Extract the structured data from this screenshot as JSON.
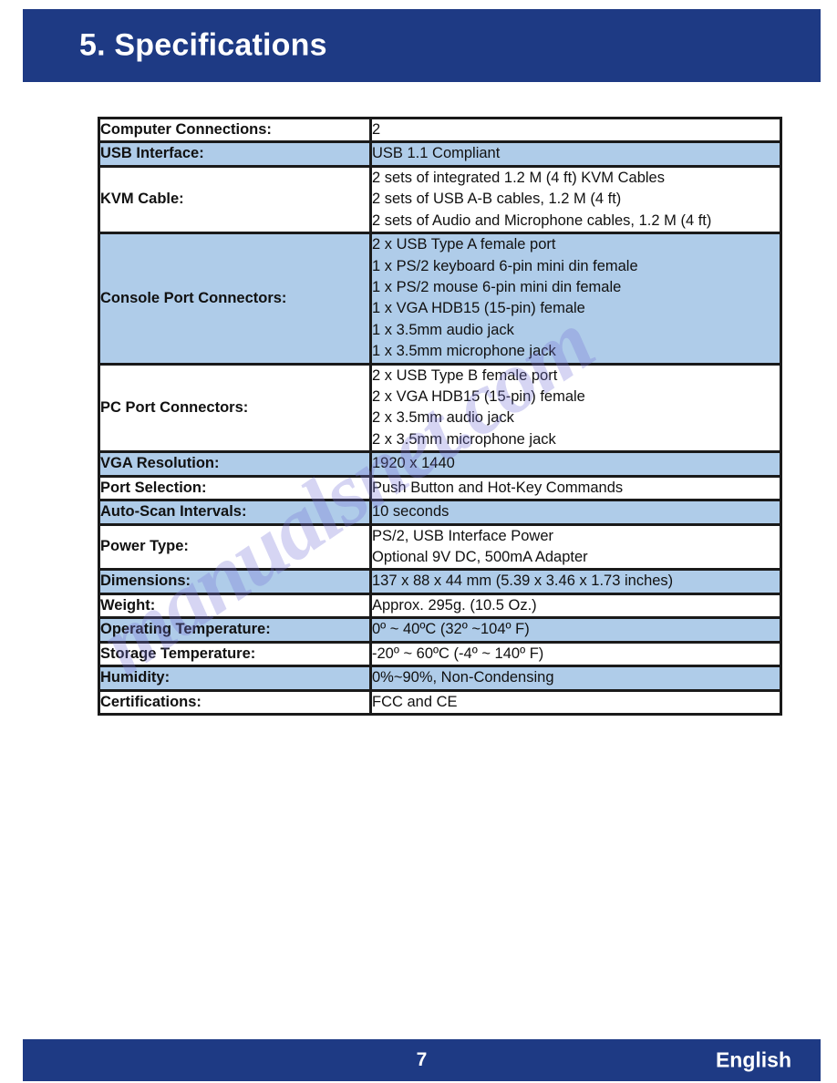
{
  "page": {
    "header_title": "5. Specifications",
    "accent_color": "#1E3A84",
    "shaded_row_color": "#AFCCE9",
    "watermark_text": "manualsnet.com"
  },
  "spec_table": {
    "rows": [
      {
        "label": "Computer Connections:",
        "value": "2",
        "shaded": false
      },
      {
        "label": "USB Interface:",
        "value": "USB 1.1 Compliant",
        "shaded": true
      },
      {
        "label": "KVM Cable:",
        "value": "2 sets of integrated 1.2 M (4 ft) KVM Cables\n2 sets of USB A-B cables, 1.2 M (4 ft)\n2 sets of Audio and Microphone cables, 1.2 M (4 ft)",
        "shaded": false
      },
      {
        "label": "Console Port Connectors:",
        "value": "2 x USB Type A female port\n1 x PS/2 keyboard 6-pin mini din female\n1 x PS/2 mouse 6-pin mini din female\n1 x VGA HDB15 (15-pin) female\n1 x 3.5mm audio jack\n1 x 3.5mm microphone jack",
        "shaded": true
      },
      {
        "label": "PC Port Connectors:",
        "value": "2 x USB Type B female port\n2 x VGA HDB15 (15-pin) female\n2 x 3.5mm audio jack\n2 x 3.5mm microphone jack",
        "shaded": false
      },
      {
        "label": "VGA Resolution:",
        "value": "1920 x 1440",
        "shaded": true
      },
      {
        "label": "Port Selection:",
        "value": "Push Button and Hot-Key Commands",
        "shaded": false
      },
      {
        "label": "Auto-Scan Intervals:",
        "value": "10 seconds",
        "shaded": true
      },
      {
        "label": "Power Type:",
        "value": "PS/2, USB Interface Power\nOptional 9V DC, 500mA Adapter",
        "shaded": false
      },
      {
        "label": "Dimensions:",
        "value": "137 x 88 x 44 mm (5.39 x 3.46 x 1.73 inches)",
        "shaded": true
      },
      {
        "label": "Weight:",
        "value": "Approx. 295g. (10.5 Oz.)",
        "shaded": false
      },
      {
        "label": "Operating Temperature:",
        "value": "0º ~ 40ºC (32º ~104º F)",
        "shaded": true
      },
      {
        "label": "Storage Temperature:",
        "value": "-20º ~ 60ºC (-4º ~ 140º F)",
        "shaded": false
      },
      {
        "label": "Humidity:",
        "value": "0%~90%, Non-Condensing",
        "shaded": true
      },
      {
        "label": "Certifications:",
        "value": "FCC and CE",
        "shaded": false
      }
    ]
  },
  "footer": {
    "page_number": "7",
    "language": "English"
  }
}
